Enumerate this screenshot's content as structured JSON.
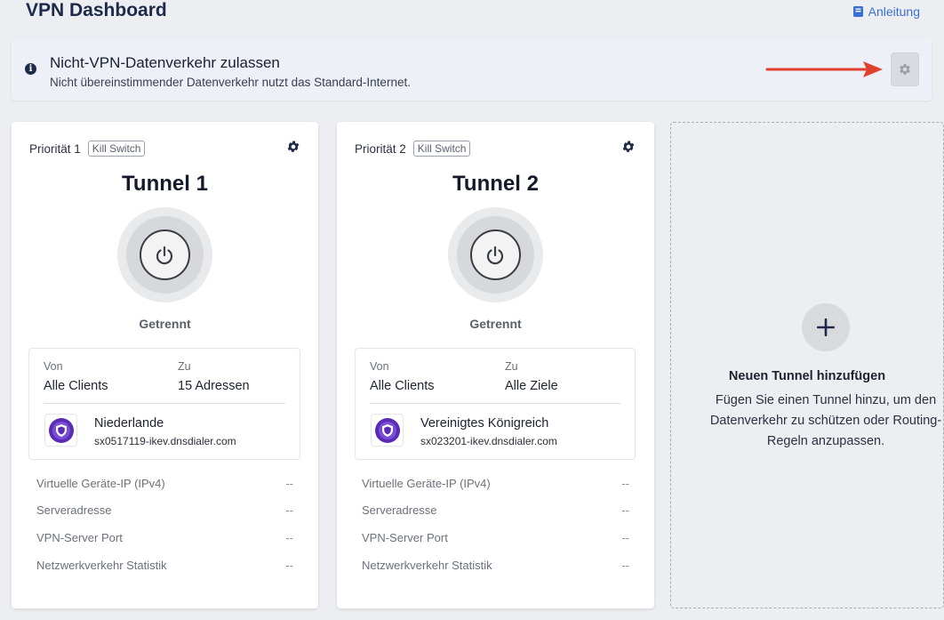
{
  "header": {
    "title": "VPN Dashboard",
    "guide_label": "Anleitung"
  },
  "banner": {
    "title": "Nicht-VPN-Datenverkehr zulassen",
    "subtitle": "Nicht übereinstimmender Datenverkehr nutzt das Standard-Internet.",
    "arrow_color": "#e0412f"
  },
  "tunnels": [
    {
      "priority": "Priorität 1",
      "badge": "Kill Switch",
      "name": "Tunnel 1",
      "status": "Getrennt",
      "from_label": "Von",
      "from_value": "Alle Clients",
      "to_label": "Zu",
      "to_value": "15 Adressen",
      "location": "Niederlande",
      "host": "sx0517119-ikev.dnsdialer.com",
      "stats": [
        {
          "label": "Virtuelle Geräte-IP (IPv4)",
          "value": "--"
        },
        {
          "label": "Serveradresse",
          "value": "--"
        },
        {
          "label": "VPN-Server Port",
          "value": "--"
        },
        {
          "label": "Netzwerkverkehr Statistik",
          "value": "--"
        }
      ]
    },
    {
      "priority": "Priorität 2",
      "badge": "Kill Switch",
      "name": "Tunnel 2",
      "status": "Getrennt",
      "from_label": "Von",
      "from_value": "Alle Clients",
      "to_label": "Zu",
      "to_value": "Alle Ziele",
      "location": "Vereinigtes Königreich",
      "host": "sx023201-ikev.dnsdialer.com",
      "stats": [
        {
          "label": "Virtuelle Geräte-IP (IPv4)",
          "value": "--"
        },
        {
          "label": "Serveradresse",
          "value": "--"
        },
        {
          "label": "VPN-Server Port",
          "value": "--"
        },
        {
          "label": "Netzwerkverkehr Statistik",
          "value": "--"
        }
      ]
    }
  ],
  "add_tunnel": {
    "title": "Neuen Tunnel hinzufügen",
    "description": "Fügen Sie einen Tunnel hinzu, um den Datenverkehr zu schützen oder Routing-Regeln anzupassen."
  },
  "colors": {
    "accent": "#3b6fd6",
    "shield": "#5b2bb5"
  }
}
